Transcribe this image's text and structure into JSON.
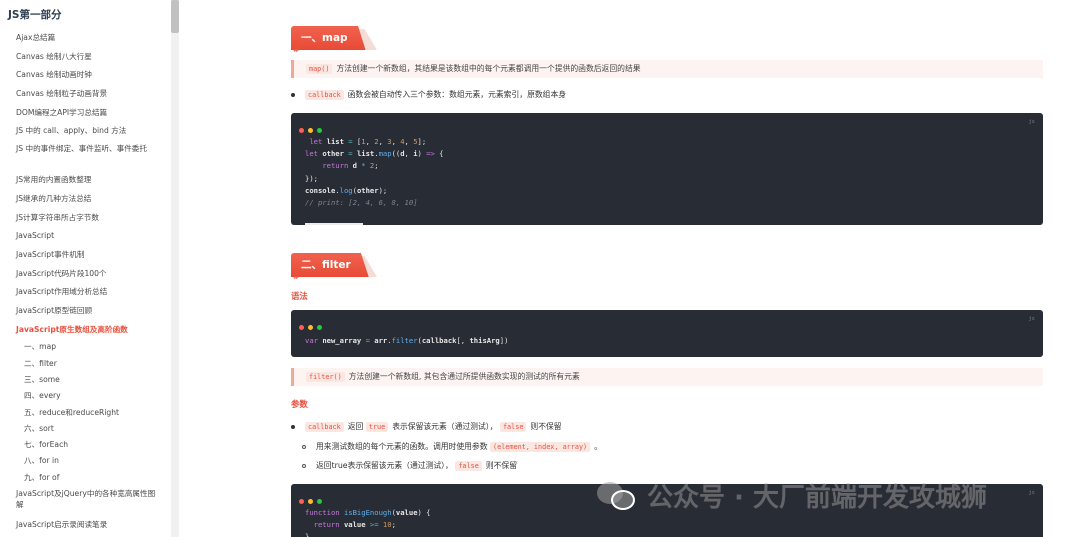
{
  "sidebar": {
    "title": "JS第一部分",
    "items": [
      "Ajax总结篇",
      "Canvas 绘制八大行星",
      "Canvas 绘制动画时钟",
      "Canvas 绘制粒子动画背景",
      "DOM编程之API学习总结篇",
      "JS 中的 call、apply、bind 方法",
      "JS 中的事件绑定、事件监听、事件委托",
      "JS常用的内置函数整理",
      "JS继承的几种方法总结",
      "JS计算字符串所占字节数",
      "JavaScript",
      "JavaScript事件机制",
      "JavaScript代码片段100个",
      "JavaScript作用域分析总结",
      "JavaScript原型链回顾",
      "JavaScript原生数组及高阶函数"
    ],
    "sub_items": [
      "一、map",
      "二、filter",
      "三、some",
      "四、every",
      "五、reduce和reduceRight",
      "六、sort",
      "七、forEach",
      "八、for in",
      "九、for of"
    ],
    "after_items": [
      "JavaScript及jQuery中的各种宽高属性图解",
      "JavaScript启示录阅读笔录"
    ]
  },
  "content": {
    "map": {
      "heading": "一、map",
      "hash": "#",
      "quote_code": "map()",
      "quote_text": "方法创建一个新数组，其结果是该数组中的每个元素都调用一个提供的函数后返回的结果",
      "bullet_code": "callback",
      "bullet_text": "函数会被自动传入三个参数：数组元素，元素索引，原数组本身",
      "code_lang": "js"
    },
    "filter": {
      "heading": "二、filter",
      "hash": "#",
      "syntax_label": "语法",
      "code_lang": "js",
      "quote_code": "filter()",
      "quote_text": "方法创建一个新数组, 其包含通过所提供函数实现的测试的所有元素",
      "params_label": "参数",
      "bullet1_code1": "callback",
      "bullet1_text1": "返回",
      "bullet1_code2": "true",
      "bullet1_text2": "表示保留该元素（通过测试），",
      "bullet1_code3": "false",
      "bullet1_text3": "则不保留",
      "sub1_text": "用来测试数组的每个元素的函数。调用时使用参数",
      "sub1_code": "(element, index, array)",
      "sub1_tail": "。",
      "sub2_text": "返回true表示保留该元素（通过测试），",
      "sub2_code": "false",
      "sub2_tail": "则不保留",
      "code2_lang": "js"
    }
  },
  "watermark": "公众号 · 大厂前端开发攻城狮",
  "colors": {
    "accent": "#e8523f",
    "code_bg": "#282c34",
    "dot_red": "#ff5f56",
    "dot_yellow": "#ffbd2e",
    "dot_green": "#27c93f"
  }
}
